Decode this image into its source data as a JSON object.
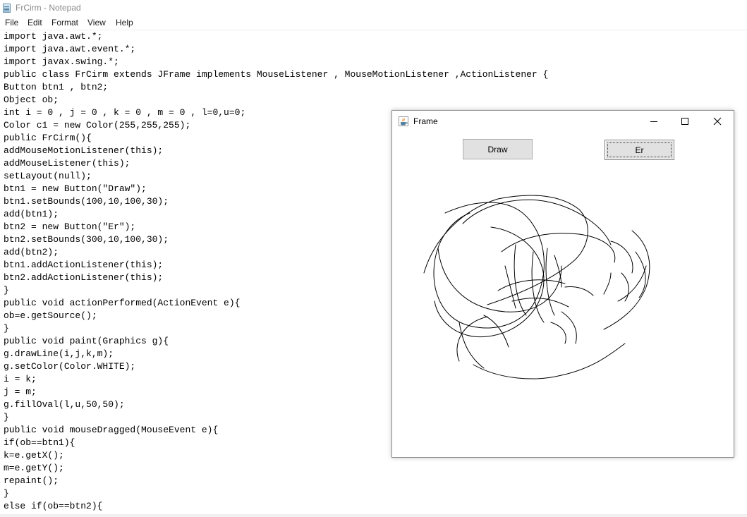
{
  "notepad": {
    "title": "FrCirm - Notepad",
    "menu": [
      "File",
      "Edit",
      "Format",
      "View",
      "Help"
    ],
    "code_lines": [
      "import java.awt.*;",
      "import java.awt.event.*;",
      "import javax.swing.*;",
      "public class FrCirm extends JFrame implements MouseListener , MouseMotionListener ,ActionListener {",
      "Button btn1 , btn2;",
      "Object ob;",
      "int i = 0 , j = 0 , k = 0 , m = 0 , l=0,u=0;",
      "Color c1 = new Color(255,255,255);",
      "public FrCirm(){",
      "addMouseMotionListener(this);",
      "addMouseListener(this);",
      "setLayout(null);",
      "btn1 = new Button(\"Draw\");",
      "btn1.setBounds(100,10,100,30);",
      "add(btn1);",
      "btn2 = new Button(\"Er\");",
      "btn2.setBounds(300,10,100,30);",
      "add(btn2);",
      "btn1.addActionListener(this);",
      "btn2.addActionListener(this);",
      "}",
      "public void actionPerformed(ActionEvent e){",
      "ob=e.getSource();",
      "}",
      "public void paint(Graphics g){",
      "g.drawLine(i,j,k,m);",
      "g.setColor(Color.WHITE);",
      "i = k;",
      "j = m;",
      "g.fillOval(l,u,50,50);",
      "}",
      "public void mouseDragged(MouseEvent e){",
      "if(ob==btn1){",
      "k=e.getX();",
      "m=e.getY();",
      "repaint();",
      "}",
      "else if(ob==btn2){"
    ]
  },
  "frame": {
    "title": "Frame",
    "icon": "java-cup-icon",
    "controls": [
      "minimize-icon",
      "maximize-icon",
      "close-icon"
    ],
    "buttons": {
      "draw_label": "Draw",
      "erase_label": "Er",
      "focused": "Er"
    },
    "drawing_color": "#000000"
  }
}
